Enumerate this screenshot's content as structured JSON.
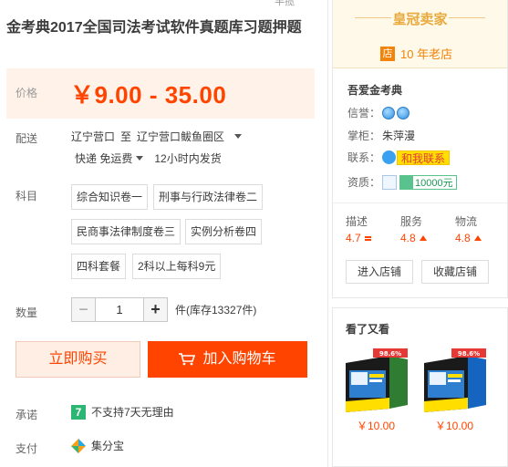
{
  "product": {
    "cut_text": "半揽",
    "title": "金考典2017全国司法考试软件真题库习题押题",
    "price_label": "价格",
    "price": "￥9.00 - 35.00",
    "shipping_label": "配送",
    "ship_from": "辽宁营口",
    "ship_to_word": "至",
    "ship_to": "辽宁营口鲅鱼圈区",
    "ship_method": "快递 免运费",
    "ship_time": "12小时内发货",
    "subject_label": "科目",
    "options": [
      "综合知识卷一",
      "刑事与行政法律卷二",
      "民商事法律制度卷三",
      "实例分析卷四",
      "四科套餐",
      "2科以上每科9元"
    ],
    "qty_label": "数量",
    "qty_minus": "−",
    "qty_value": "1",
    "qty_plus": "+",
    "qty_stock": "件(库存13327件)",
    "buy_now": "立即购买",
    "add_cart": "加入购物车",
    "promise_label": "承诺",
    "promise_icon": "7",
    "promise_text": "不支持7天无理由",
    "pay_label": "支付",
    "pay_text": "集分宝"
  },
  "shop": {
    "crown_title": "皇冠卖家",
    "dian_badge": "店",
    "years": "10 年老店",
    "name": "吾爱金考典",
    "credit_label": "信誉：",
    "owner_label": "掌柜：",
    "owner": "朱萍漫",
    "contact_label": "联系：",
    "contact_btn": "和我联系",
    "qual_label": "资质：",
    "qual_badge": "10000元",
    "scores": [
      {
        "label": "描述",
        "value": "4.7"
      },
      {
        "label": "服务",
        "value": "4.8"
      },
      {
        "label": "物流",
        "value": "4.8"
      }
    ],
    "enter_shop": "进入店铺",
    "fav_shop": "收藏店铺"
  },
  "also": {
    "title": "看了又看",
    "items": [
      {
        "price": "￥10.00",
        "badge": "98.6%"
      },
      {
        "price": "￥10.00",
        "badge": "98.6%"
      }
    ]
  },
  "colors": {
    "accent": "#ff4400",
    "price_bg": "#fff2e8",
    "crown": "#e8a93d",
    "gold_badge": "#f2830b"
  }
}
